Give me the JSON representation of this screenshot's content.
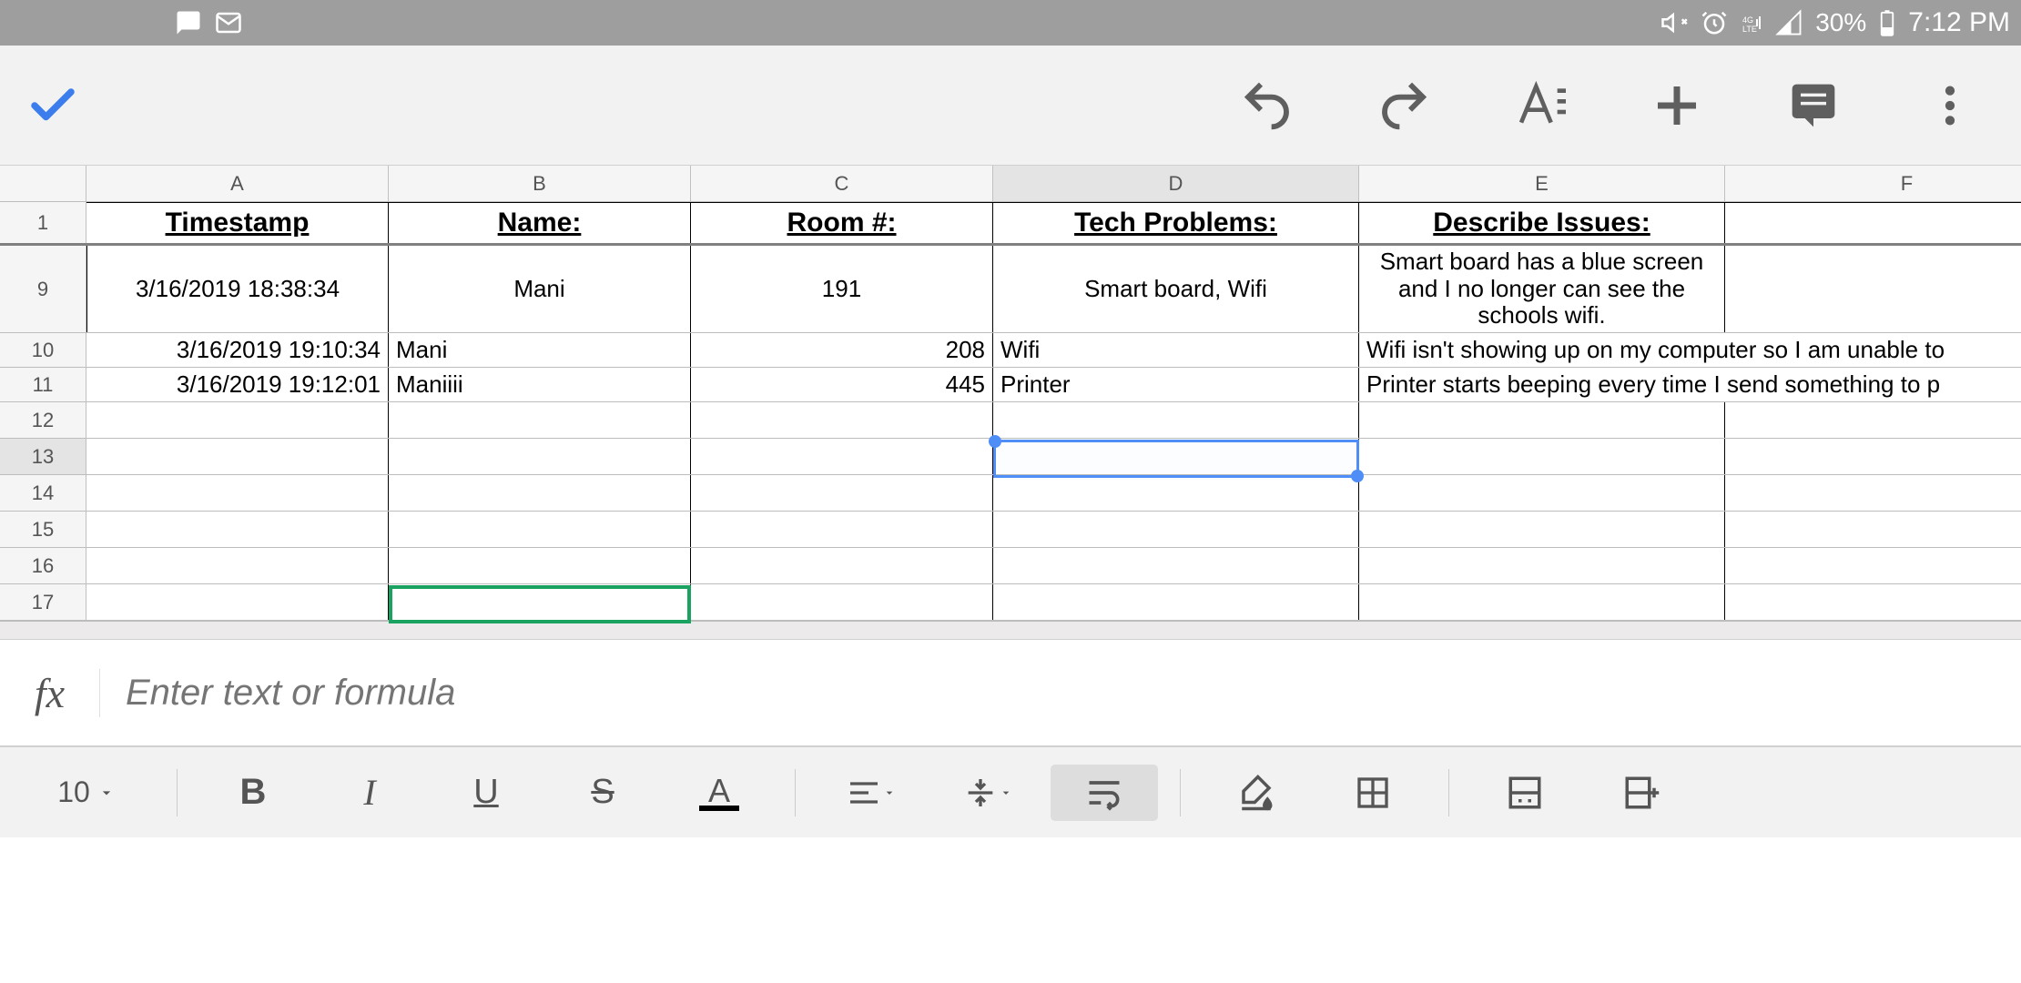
{
  "status": {
    "battery": "30%",
    "time": "7:12 PM"
  },
  "columns": [
    "A",
    "B",
    "C",
    "D",
    "E",
    "F"
  ],
  "headers": {
    "A": "Timestamp",
    "B": "Name:",
    "C": "Room #:",
    "D": "Tech Problems:",
    "E": "Describe Issues:"
  },
  "rowNums": {
    "header": "1",
    "big": "9",
    "d1": "10",
    "d2": "11",
    "e12": "12",
    "e13": "13",
    "e14": "14",
    "e15": "15",
    "e16": "16",
    "e17": "17"
  },
  "bigRow": {
    "A": "3/16/2019 18:38:34",
    "B": "Mani",
    "C": "191",
    "D": "Smart board, Wifi",
    "E": "Smart board has a blue screen and I no longer can see the schools wifi."
  },
  "dataRows": [
    {
      "A": "3/16/2019 19:10:34",
      "B": "Mani",
      "C": "208",
      "D": "Wifi",
      "E": "Wifi isn't showing up on my computer so I am unable to"
    },
    {
      "A": "3/16/2019 19:12:01",
      "B": "Maniiii",
      "C": "445",
      "D": "Printer",
      "E": "Printer starts beeping every time I send something to p"
    }
  ],
  "formulaBar": {
    "placeholder": "Enter text or formula"
  },
  "toolbar": {
    "fontSize": "10"
  },
  "selectedCell": "D13",
  "activeCell": "B17"
}
